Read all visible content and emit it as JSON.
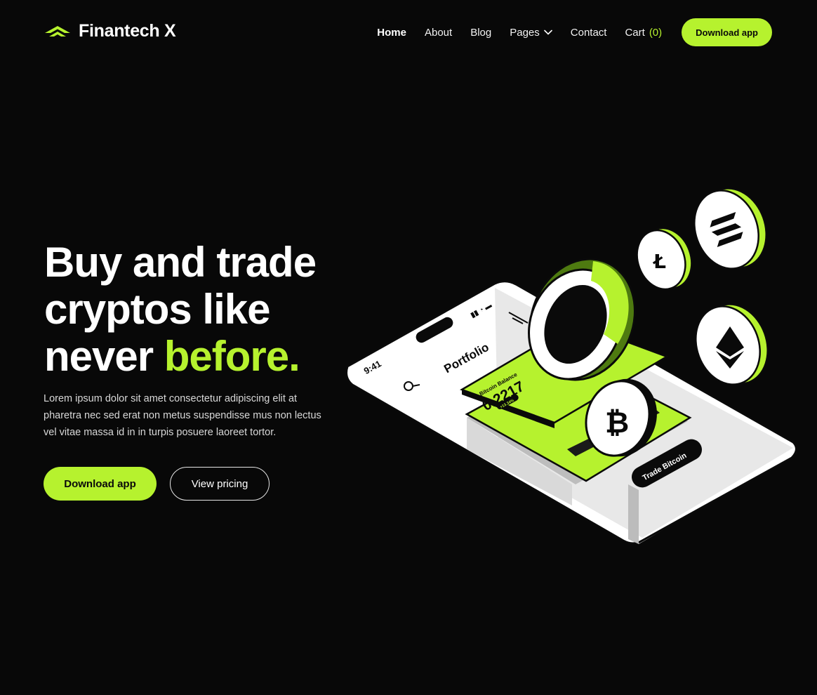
{
  "brand": {
    "name": "Finantech X"
  },
  "nav": {
    "items": [
      {
        "label": "Home",
        "active": true
      },
      {
        "label": "About"
      },
      {
        "label": "Blog"
      },
      {
        "label": "Pages",
        "dropdown": true
      },
      {
        "label": "Contact"
      }
    ],
    "cart_label": "Cart",
    "cart_count": "(0)",
    "download_label": "Download app"
  },
  "hero": {
    "title_line1": "Buy and trade",
    "title_line2": "cryptos like",
    "title_line3_prefix": "never ",
    "title_line3_accent": "before.",
    "description": "Lorem ipsum dolor sit amet consectetur adipiscing elit at pharetra nec sed erat non metus suspendisse mus non lectus vel vitae massa id in in turpis posuere laoreet tortor.",
    "primary_button": "Download app",
    "secondary_button": "View pricing"
  },
  "illustration": {
    "phone_time": "9:41",
    "phone_title": "Portfolio",
    "balance_label": "Bitcoin Balance",
    "balance_value": "0.2217",
    "change_badge": "+13.34%",
    "trade_button": "Trade Bitcoin",
    "coins": [
      "bitcoin-icon",
      "litecoin-icon",
      "solana-icon",
      "ethereum-icon"
    ]
  },
  "colors": {
    "accent": "#b6f22e",
    "background": "#080808",
    "accent_dark": "#4e7a10"
  }
}
